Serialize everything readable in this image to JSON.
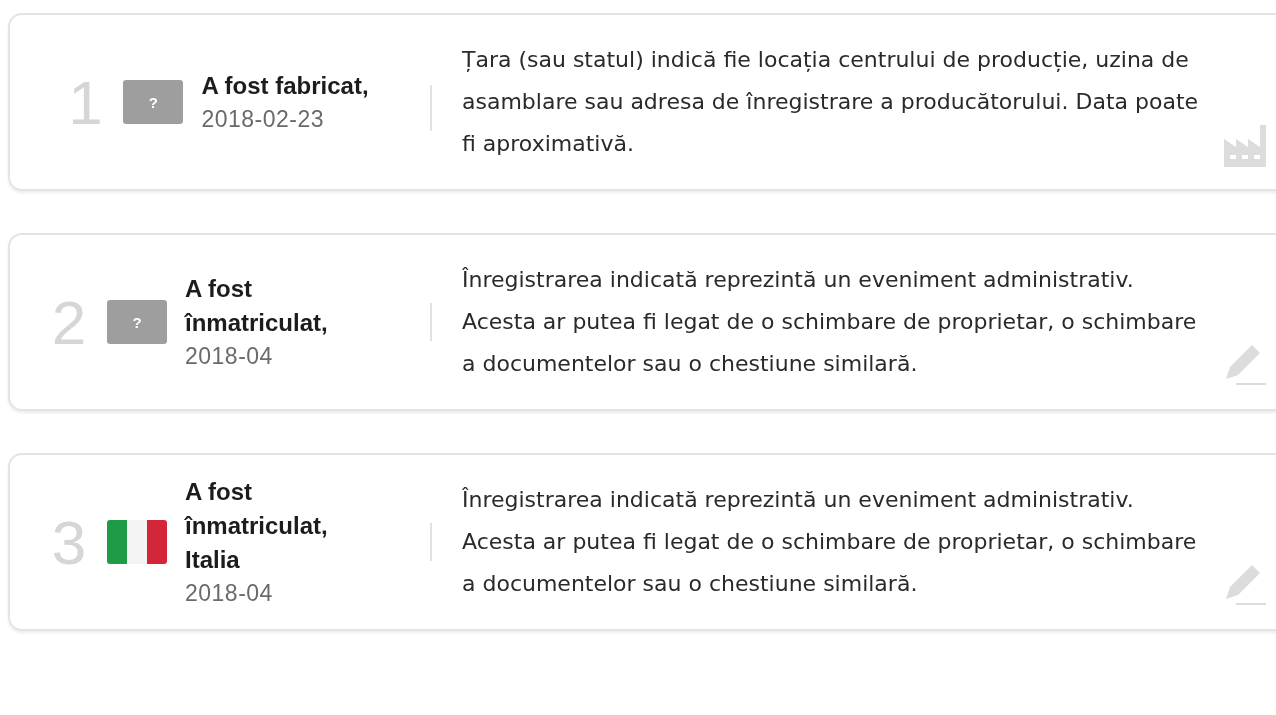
{
  "events": [
    {
      "number": "1",
      "flag": {
        "kind": "unknown",
        "text": "?"
      },
      "title": "A fost fabricat,",
      "date": "2018-02-23",
      "description": "Țara (sau statul) indică fie locația centrului de producție, uzina de asamblare sau adresa de înregistrare a producătorului. Data poate fi aproximativă.",
      "kind": "factory"
    },
    {
      "number": "2",
      "flag": {
        "kind": "unknown",
        "text": "?"
      },
      "title": "A fost înmatriculat,",
      "date": "2018-04",
      "description": "Înregistrarea indicată reprezintă un eveniment administrativ. Acesta ar putea fi legat de o schimbare de proprietar, o schimbare a documentelor sau o chestiune similară.",
      "kind": "pencil"
    },
    {
      "number": "3",
      "flag": {
        "kind": "italy"
      },
      "title": "A fost înmatriculat, Italia",
      "date": "2018-04",
      "description": "Înregistrarea indicată reprezintă un eveniment administrativ. Acesta ar putea fi legat de o schimbare de proprietar, o schimbare a documentelor sau o chestiune similară.",
      "kind": "pencil"
    }
  ]
}
